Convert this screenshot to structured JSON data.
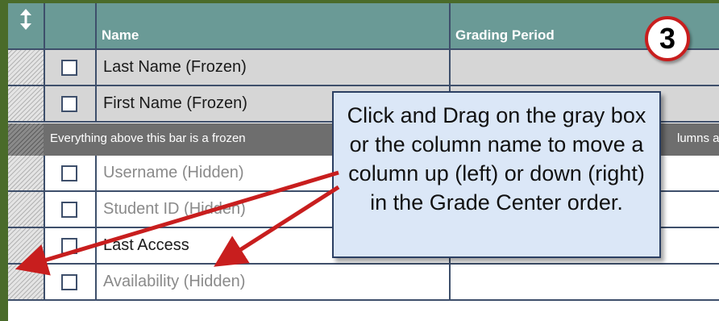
{
  "header": {
    "sort_icon": "double-arrow-updown-icon",
    "name_label": "Name",
    "grading_period_label": "Grading Period"
  },
  "step_badge": "3",
  "rows": [
    {
      "name": "Last Name (Frozen)",
      "state": "frozen"
    },
    {
      "name": "First Name (Frozen)",
      "state": "frozen"
    },
    {
      "name": "Username (Hidden)",
      "state": "hidden"
    },
    {
      "name": "Student ID (Hidden)",
      "state": "hidden"
    },
    {
      "name": "Last Access",
      "state": "normal"
    },
    {
      "name": "Availability (Hidden)",
      "state": "hidden"
    }
  ],
  "frozen_bar": {
    "text_left": "Everything above this bar is a frozen",
    "text_right": "lumns a"
  },
  "callout": {
    "text": "Click and Drag on the gray box or the column name to move a column up (left) or down (right) in the Grade Center order."
  },
  "colors": {
    "header_bg": "#6a9a96",
    "frozen_row_bg": "#d6d6d6",
    "bar_bg": "#6e6e6e",
    "callout_bg": "#dbe7f7",
    "arrow": "#c81e1e",
    "frame_green": "#4a6b2a"
  }
}
